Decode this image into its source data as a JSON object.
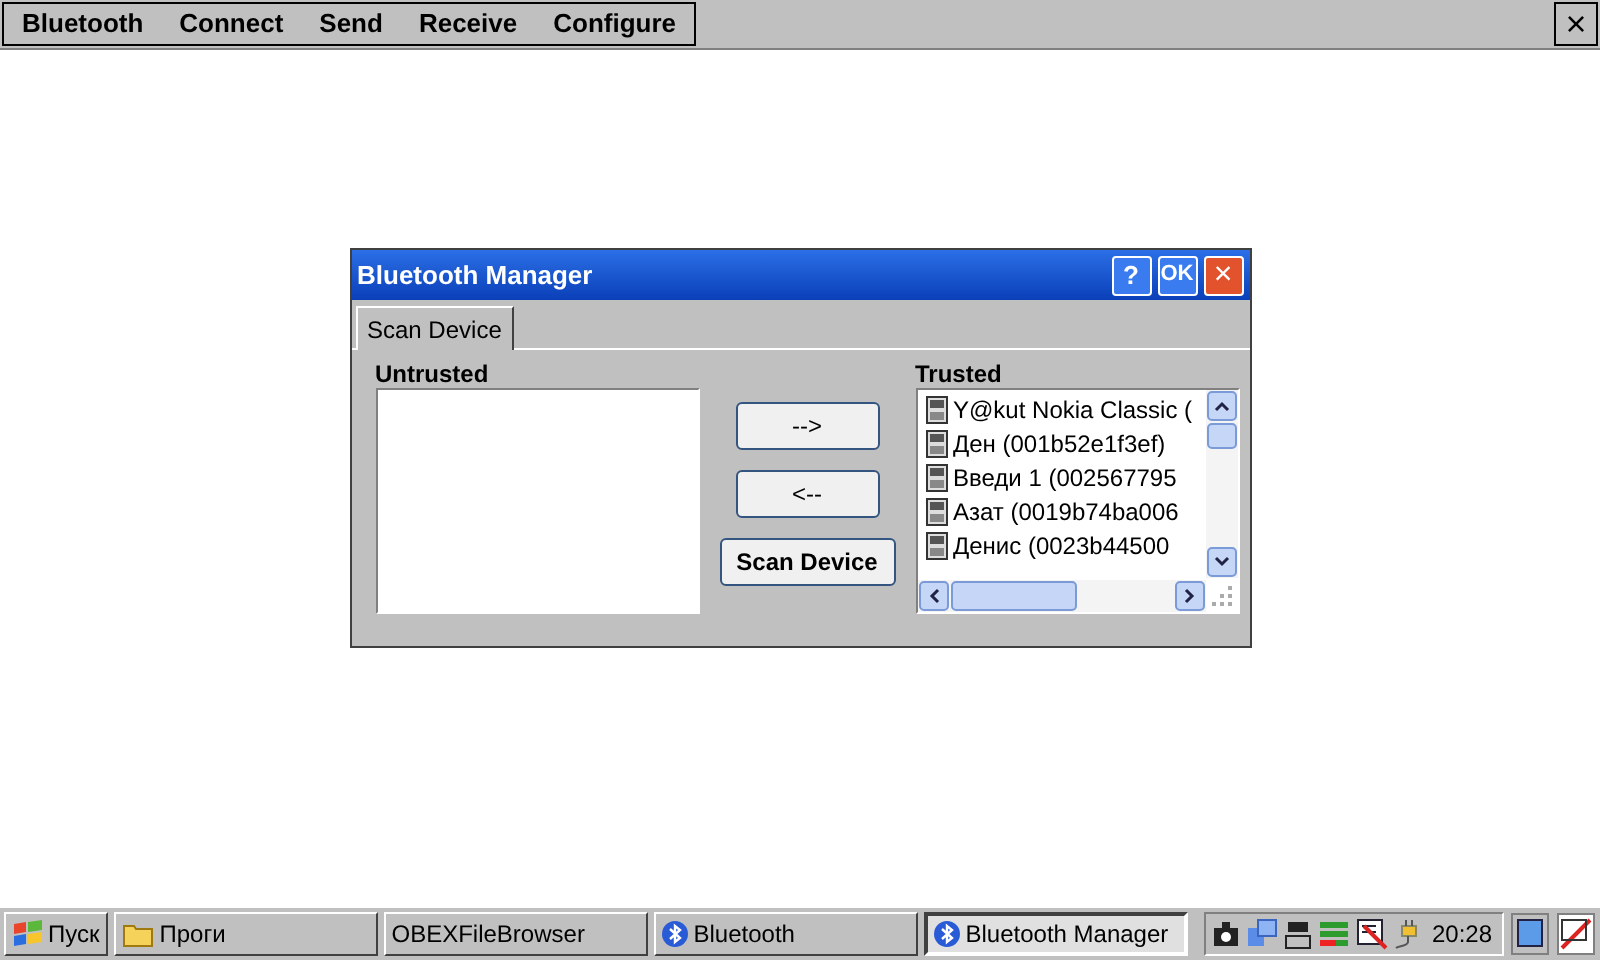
{
  "menu_bar": {
    "items": [
      "Bluetooth",
      "Connect",
      "Send",
      "Receive",
      "Configure"
    ],
    "close": "×"
  },
  "dialog": {
    "title": "Bluetooth Manager",
    "help": "?",
    "ok": "OK",
    "close": "×",
    "tabs": [
      {
        "label": "Scan Device",
        "selected": true
      }
    ],
    "untrusted": {
      "label": "Untrusted"
    },
    "buttons": [
      "-->",
      "<--",
      "Scan Device"
    ],
    "trusted": {
      "label": "Trusted",
      "items": [
        "Y@kut Nokia Classic (",
        "Ден (001b52e1f3ef)",
        "Введи 1 (002567795",
        "Азат (0019b74ba006",
        "Денис (0023b44500"
      ]
    }
  },
  "taskbar": {
    "start": "Пуск",
    "tasks": [
      {
        "label": "Проги",
        "kind": "folder",
        "selected": false
      },
      {
        "label": "OBEXFileBrowser",
        "kind": "plain",
        "selected": false
      },
      {
        "label": "Bluetooth",
        "kind": "bluetooth",
        "selected": false
      },
      {
        "label": "Bluetooth Manager",
        "kind": "bluetooth",
        "selected": true
      }
    ],
    "clock": "20:28"
  }
}
